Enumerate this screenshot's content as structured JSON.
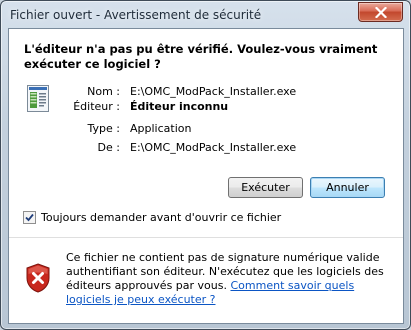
{
  "window": {
    "title": "Fichier ouvert - Avertissement de sécurité"
  },
  "heading": "L'éditeur n'a pas pu être vérifié. Voulez-vous vraiment exécuter ce logiciel ?",
  "file_info": {
    "name_label": "Nom :",
    "name_value": "E:\\OMC_ModPack_Installer.exe",
    "publisher_label": "Éditeur :",
    "publisher_value": "Éditeur inconnu",
    "type_label": "Type :",
    "type_value": "Application",
    "from_label": "De :",
    "from_value": "E:\\OMC_ModPack_Installer.exe"
  },
  "buttons": {
    "run": "Exécuter",
    "cancel": "Annuler"
  },
  "checkbox": {
    "label": "Toujours demander avant d'ouvrir ce fichier",
    "checked": true
  },
  "warning": {
    "text": "Ce fichier ne contient pas de signature numérique valide authentifiant son éditeur. N'exécutez que les logiciels des éditeurs approuvés par vous. ",
    "link": "Comment savoir quels logiciels je peux exécuter ?"
  },
  "icons": {
    "close": "close-icon",
    "file": "application-file-icon",
    "shield": "security-shield-error-icon",
    "check": "checkmark-icon"
  },
  "colors": {
    "link": "#0b55c4",
    "shield_red": "#c8281e",
    "close_button": "#c2472d"
  }
}
